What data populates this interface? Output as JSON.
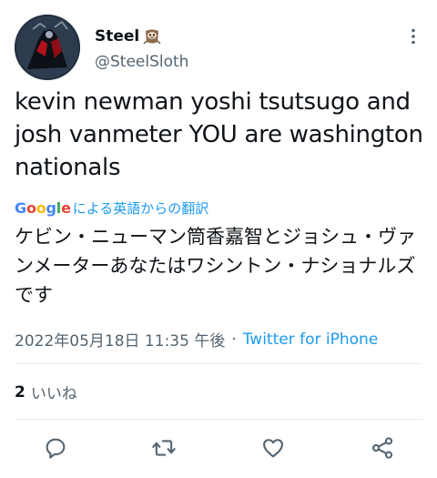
{
  "tweet": {
    "display_name": "Steel",
    "handle": "@SteelSloth",
    "text": "kevin newman yoshi tsutsugo and josh vanmeter YOU are washington nationals",
    "translation_label": "による英語からの翻訳",
    "translated_text": "ケビン・ニューマン筒香嘉智とジョシュ・ヴァンメーターあなたはワシントン・ナショナルズです",
    "timestamp": "2022年05月18日 11:35 午後",
    "separator": "·",
    "source": "Twitter for iPhone"
  },
  "stats": {
    "likes_count": "2",
    "likes_label": "いいね"
  },
  "branding": {
    "google_letters": [
      "G",
      "o",
      "o",
      "g",
      "l",
      "e"
    ],
    "google_colors": [
      "#4285F4",
      "#EA4335",
      "#FBBC05",
      "#4285F4",
      "#34A853",
      "#EA4335"
    ]
  },
  "icons": {
    "more": "more-vertical-icon",
    "reply": "reply-icon",
    "retweet": "retweet-icon",
    "like": "heart-icon",
    "share": "share-icon",
    "emoji": "sloth-emoji"
  },
  "colors": {
    "text": "#0f1419",
    "secondary": "#536471",
    "link": "#1d9bf0",
    "divider": "#e7ebee"
  }
}
